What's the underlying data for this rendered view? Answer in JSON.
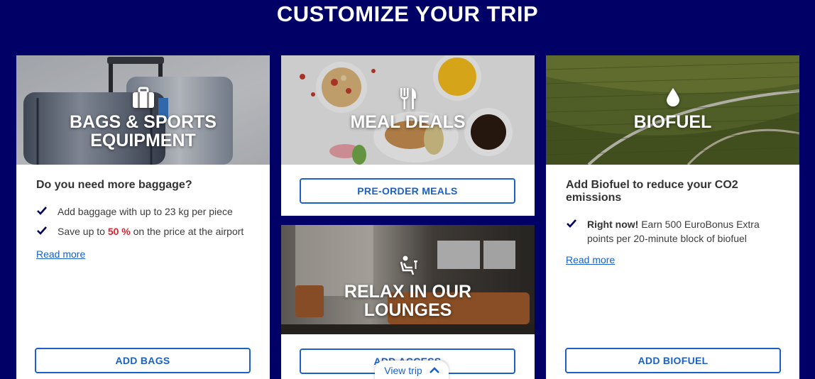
{
  "page": {
    "title": "CUSTOMIZE YOUR TRIP"
  },
  "colors": {
    "background": "#000066",
    "accent": "#1a61c9",
    "highlight": "#e0222d"
  },
  "cards": {
    "bags": {
      "title_line1": "BAGS & SPORTS",
      "title_line2": "EQUIPMENT",
      "icon": "suitcase-icon",
      "heading": "Do you need more baggage?",
      "feature1": "Add baggage with up to 23 kg per piece",
      "feature2_pre": "Save up to ",
      "feature2_highlight": "50 %",
      "feature2_post": " on the price at the airport",
      "read_more": "Read more",
      "button": "ADD BAGS"
    },
    "meals": {
      "title": "MEAL DEALS",
      "icon": "fork-knife-icon",
      "button": "PRE-ORDER MEALS"
    },
    "lounges": {
      "title_line1": "RELAX IN OUR",
      "title_line2": "LOUNGES",
      "icon": "lounge-chair-icon",
      "button": "ADD ACCESS"
    },
    "biofuel": {
      "title": "BIOFUEL",
      "icon": "droplet-icon",
      "heading": "Add Biofuel to reduce your CO2 emissions",
      "feature1_strong": "Right now!",
      "feature1_rest": " Earn 500 EuroBonus Extra points per 20-minute block of biofuel",
      "read_more": "Read more",
      "button": "ADD BIOFUEL"
    }
  },
  "view_trip": {
    "label": "View trip",
    "icon": "chevron-up-icon"
  }
}
